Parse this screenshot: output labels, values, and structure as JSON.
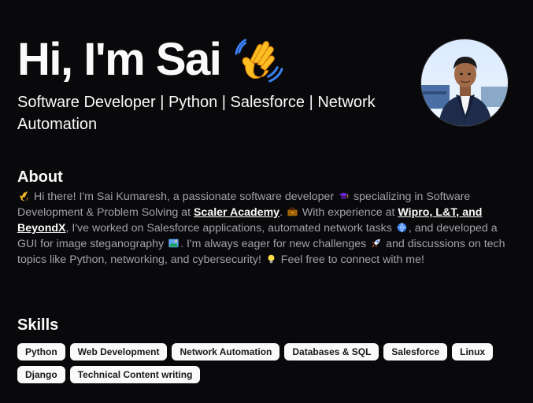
{
  "hero": {
    "greeting": "Hi, I'm Sai",
    "wave_icon": "waving-hand-icon",
    "subtitle": "Software Developer | Python | Salesforce | Network Automation"
  },
  "avatar": {
    "icon": "profile-photo"
  },
  "about": {
    "title": "About",
    "p1": " Hi there! I'm Sai Kumaresh, a passionate software developer ",
    "p2": " specializing in Software Development & Problem Solving at ",
    "link_scaler": "Scaler Academy",
    "p3": ". ",
    "p4": " With experience at ",
    "link_companies": "Wipro, L&T, and BeyondX",
    "p5": ", I've worked on Salesforce applications, automated network tasks ",
    "p6": ", and developed a GUI for image steganography ",
    "p7": ". I'm always eager for new challenges ",
    "p8": " and discussions on tech topics like Python, networking, and cybersecurity! ",
    "p9": " Feel free to connect with me!"
  },
  "skills": {
    "title": "Skills",
    "items": [
      "Python",
      "Web Development",
      "Network Automation",
      "Databases & SQL",
      "Salesforce",
      "Linux",
      "Django",
      "Technical Content writing"
    ]
  },
  "colors": {
    "background": "#09090b",
    "muted_text": "#a1a1aa",
    "chip_bg": "#fafafa"
  }
}
